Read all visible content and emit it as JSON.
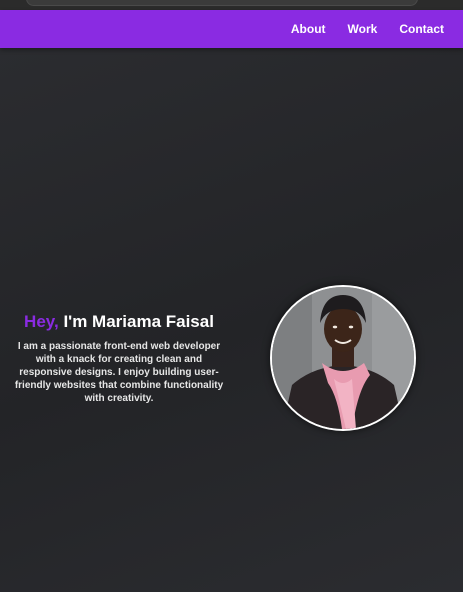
{
  "nav": {
    "links": [
      {
        "label": "About"
      },
      {
        "label": "Work"
      },
      {
        "label": "Contact"
      }
    ]
  },
  "hero": {
    "greeting": "Hey,",
    "name": "I'm Mariama Faisal",
    "description": "I am a passionate front-end web developer with a knack for creating clean and responsive designs. I enjoy building user-friendly websites that combine functionality with creativity."
  },
  "colors": {
    "accent": "#8a2be2",
    "background": "#27282b",
    "text": "#ffffff"
  },
  "icons": {
    "avatar": "profile-photo"
  }
}
